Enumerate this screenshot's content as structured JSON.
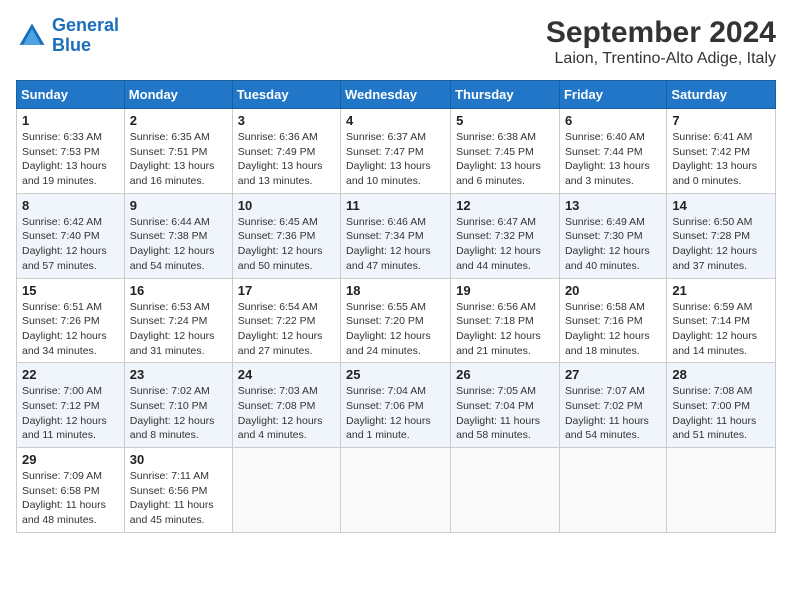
{
  "header": {
    "logo_line1": "General",
    "logo_line2": "Blue",
    "title": "September 2024",
    "subtitle": "Laion, Trentino-Alto Adige, Italy"
  },
  "columns": [
    "Sunday",
    "Monday",
    "Tuesday",
    "Wednesday",
    "Thursday",
    "Friday",
    "Saturday"
  ],
  "weeks": [
    [
      {
        "day": "1",
        "info": "Sunrise: 6:33 AM\nSunset: 7:53 PM\nDaylight: 13 hours\nand 19 minutes."
      },
      {
        "day": "2",
        "info": "Sunrise: 6:35 AM\nSunset: 7:51 PM\nDaylight: 13 hours\nand 16 minutes."
      },
      {
        "day": "3",
        "info": "Sunrise: 6:36 AM\nSunset: 7:49 PM\nDaylight: 13 hours\nand 13 minutes."
      },
      {
        "day": "4",
        "info": "Sunrise: 6:37 AM\nSunset: 7:47 PM\nDaylight: 13 hours\nand 10 minutes."
      },
      {
        "day": "5",
        "info": "Sunrise: 6:38 AM\nSunset: 7:45 PM\nDaylight: 13 hours\nand 6 minutes."
      },
      {
        "day": "6",
        "info": "Sunrise: 6:40 AM\nSunset: 7:44 PM\nDaylight: 13 hours\nand 3 minutes."
      },
      {
        "day": "7",
        "info": "Sunrise: 6:41 AM\nSunset: 7:42 PM\nDaylight: 13 hours\nand 0 minutes."
      }
    ],
    [
      {
        "day": "8",
        "info": "Sunrise: 6:42 AM\nSunset: 7:40 PM\nDaylight: 12 hours\nand 57 minutes."
      },
      {
        "day": "9",
        "info": "Sunrise: 6:44 AM\nSunset: 7:38 PM\nDaylight: 12 hours\nand 54 minutes."
      },
      {
        "day": "10",
        "info": "Sunrise: 6:45 AM\nSunset: 7:36 PM\nDaylight: 12 hours\nand 50 minutes."
      },
      {
        "day": "11",
        "info": "Sunrise: 6:46 AM\nSunset: 7:34 PM\nDaylight: 12 hours\nand 47 minutes."
      },
      {
        "day": "12",
        "info": "Sunrise: 6:47 AM\nSunset: 7:32 PM\nDaylight: 12 hours\nand 44 minutes."
      },
      {
        "day": "13",
        "info": "Sunrise: 6:49 AM\nSunset: 7:30 PM\nDaylight: 12 hours\nand 40 minutes."
      },
      {
        "day": "14",
        "info": "Sunrise: 6:50 AM\nSunset: 7:28 PM\nDaylight: 12 hours\nand 37 minutes."
      }
    ],
    [
      {
        "day": "15",
        "info": "Sunrise: 6:51 AM\nSunset: 7:26 PM\nDaylight: 12 hours\nand 34 minutes."
      },
      {
        "day": "16",
        "info": "Sunrise: 6:53 AM\nSunset: 7:24 PM\nDaylight: 12 hours\nand 31 minutes."
      },
      {
        "day": "17",
        "info": "Sunrise: 6:54 AM\nSunset: 7:22 PM\nDaylight: 12 hours\nand 27 minutes."
      },
      {
        "day": "18",
        "info": "Sunrise: 6:55 AM\nSunset: 7:20 PM\nDaylight: 12 hours\nand 24 minutes."
      },
      {
        "day": "19",
        "info": "Sunrise: 6:56 AM\nSunset: 7:18 PM\nDaylight: 12 hours\nand 21 minutes."
      },
      {
        "day": "20",
        "info": "Sunrise: 6:58 AM\nSunset: 7:16 PM\nDaylight: 12 hours\nand 18 minutes."
      },
      {
        "day": "21",
        "info": "Sunrise: 6:59 AM\nSunset: 7:14 PM\nDaylight: 12 hours\nand 14 minutes."
      }
    ],
    [
      {
        "day": "22",
        "info": "Sunrise: 7:00 AM\nSunset: 7:12 PM\nDaylight: 12 hours\nand 11 minutes."
      },
      {
        "day": "23",
        "info": "Sunrise: 7:02 AM\nSunset: 7:10 PM\nDaylight: 12 hours\nand 8 minutes."
      },
      {
        "day": "24",
        "info": "Sunrise: 7:03 AM\nSunset: 7:08 PM\nDaylight: 12 hours\nand 4 minutes."
      },
      {
        "day": "25",
        "info": "Sunrise: 7:04 AM\nSunset: 7:06 PM\nDaylight: 12 hours\nand 1 minute."
      },
      {
        "day": "26",
        "info": "Sunrise: 7:05 AM\nSunset: 7:04 PM\nDaylight: 11 hours\nand 58 minutes."
      },
      {
        "day": "27",
        "info": "Sunrise: 7:07 AM\nSunset: 7:02 PM\nDaylight: 11 hours\nand 54 minutes."
      },
      {
        "day": "28",
        "info": "Sunrise: 7:08 AM\nSunset: 7:00 PM\nDaylight: 11 hours\nand 51 minutes."
      }
    ],
    [
      {
        "day": "29",
        "info": "Sunrise: 7:09 AM\nSunset: 6:58 PM\nDaylight: 11 hours\nand 48 minutes."
      },
      {
        "day": "30",
        "info": "Sunrise: 7:11 AM\nSunset: 6:56 PM\nDaylight: 11 hours\nand 45 minutes."
      },
      null,
      null,
      null,
      null,
      null
    ]
  ]
}
